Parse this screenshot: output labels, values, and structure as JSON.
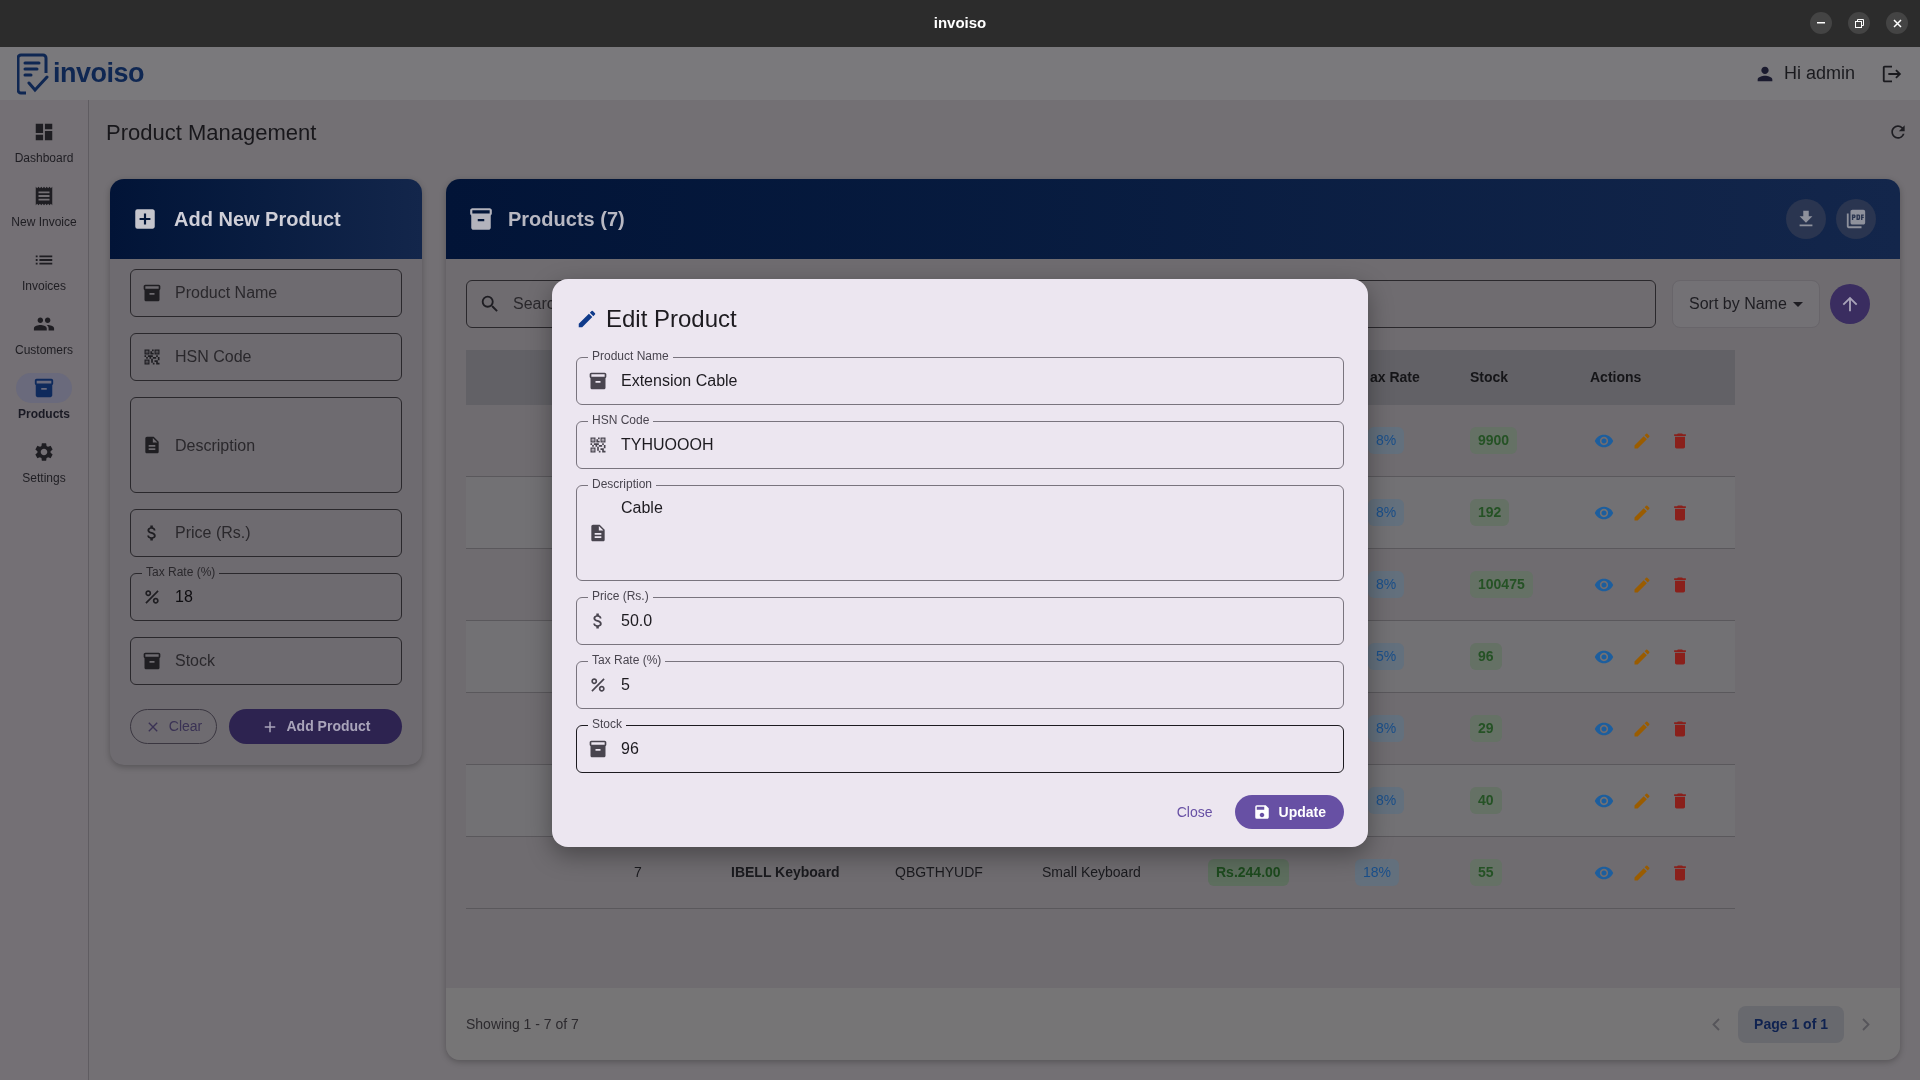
{
  "window": {
    "title": "invoiso"
  },
  "app": {
    "logo_text": "invoiso",
    "user_greeting": "Hi admin"
  },
  "sidebar": {
    "items": [
      {
        "label": "Dashboard",
        "selected": false
      },
      {
        "label": "New Invoice",
        "selected": false
      },
      {
        "label": "Invoices",
        "selected": false
      },
      {
        "label": "Customers",
        "selected": false
      },
      {
        "label": "Products",
        "selected": true
      },
      {
        "label": "Settings",
        "selected": false
      }
    ]
  },
  "page_title": "Product Management",
  "add_form": {
    "title": "Add New Product",
    "fields": [
      {
        "kind": "text",
        "placeholder": "Product Name"
      },
      {
        "kind": "text",
        "placeholder": "HSN Code"
      },
      {
        "kind": "multiline",
        "placeholder": "Description"
      },
      {
        "kind": "text",
        "placeholder": "Price (Rs.)"
      },
      {
        "kind": "text",
        "label": "Tax Rate (%)",
        "value": "18"
      },
      {
        "kind": "text",
        "placeholder": "Stock"
      }
    ],
    "buttons": [
      {
        "kind": "outlined",
        "label": "Clear"
      },
      {
        "kind": "filled",
        "label": "Add Product"
      }
    ]
  },
  "products": {
    "title": "Products (7)",
    "search": {
      "placeholder": "Searc"
    },
    "sort": {
      "label": "Sort by Name"
    },
    "table": {
      "columns": [
        "ax Rate",
        "Stock",
        "Actions"
      ],
      "rows": [
        {
          "tax": "8%",
          "stock": "9900"
        },
        {
          "tax": "8%",
          "stock": "192"
        },
        {
          "tax": "8%",
          "stock": "100475"
        },
        {
          "tax": "5%",
          "stock": "96"
        },
        {
          "tax": "8%",
          "stock": "29"
        },
        {
          "tax": "8%",
          "stock": "40"
        },
        {
          "number": "7",
          "name": "IBELL Keyboard",
          "hsn": "QBGTHYUDF",
          "description": "Small Keyboard",
          "price": "Rs.244.00",
          "tax": "18%",
          "stock": "55"
        }
      ]
    },
    "footer": {
      "showing": "Showing 1 - 7 of 7",
      "page": "Page 1 of 1"
    }
  },
  "dialog": {
    "title": "Edit Product",
    "fields": [
      {
        "kind": "text",
        "label": "Product Name",
        "value": "Extension Cable",
        "focused": false
      },
      {
        "kind": "text",
        "label": "HSN Code",
        "value": "TYHUOOOH",
        "focused": false
      },
      {
        "kind": "multiline",
        "label": "Description",
        "value": "Cable",
        "focused": false
      },
      {
        "kind": "text",
        "label": "Price (Rs.)",
        "value": "50.0",
        "focused": false
      },
      {
        "kind": "text",
        "label": "Tax Rate (%)",
        "value": "5",
        "focused": false
      },
      {
        "kind": "text",
        "label": "Stock",
        "value": "96",
        "focused": true
      }
    ],
    "buttons": [
      {
        "kind": "text",
        "label": "Close"
      },
      {
        "kind": "filled",
        "label": "Update"
      }
    ]
  }
}
